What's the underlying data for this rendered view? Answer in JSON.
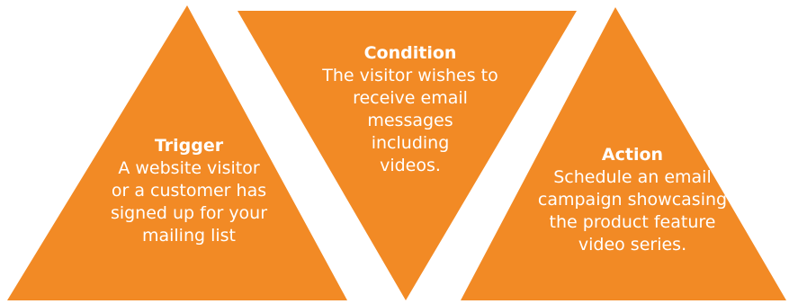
{
  "colors": {
    "shape_fill": "#F28A25",
    "text": "#FFFFFF",
    "background": "#FFFFFF"
  },
  "shapes": {
    "trigger": {
      "title": "Trigger",
      "body": "A website visitor\nor a customer has\nsigned up for your\nmailing list"
    },
    "condition": {
      "title": "Condition",
      "body": "The visitor wishes to\nreceive email\nmessages\nincluding\nvideos."
    },
    "action": {
      "title": "Action",
      "body": "Schedule an email\ncampaign showcasing\nthe product feature\nvideo series."
    }
  }
}
